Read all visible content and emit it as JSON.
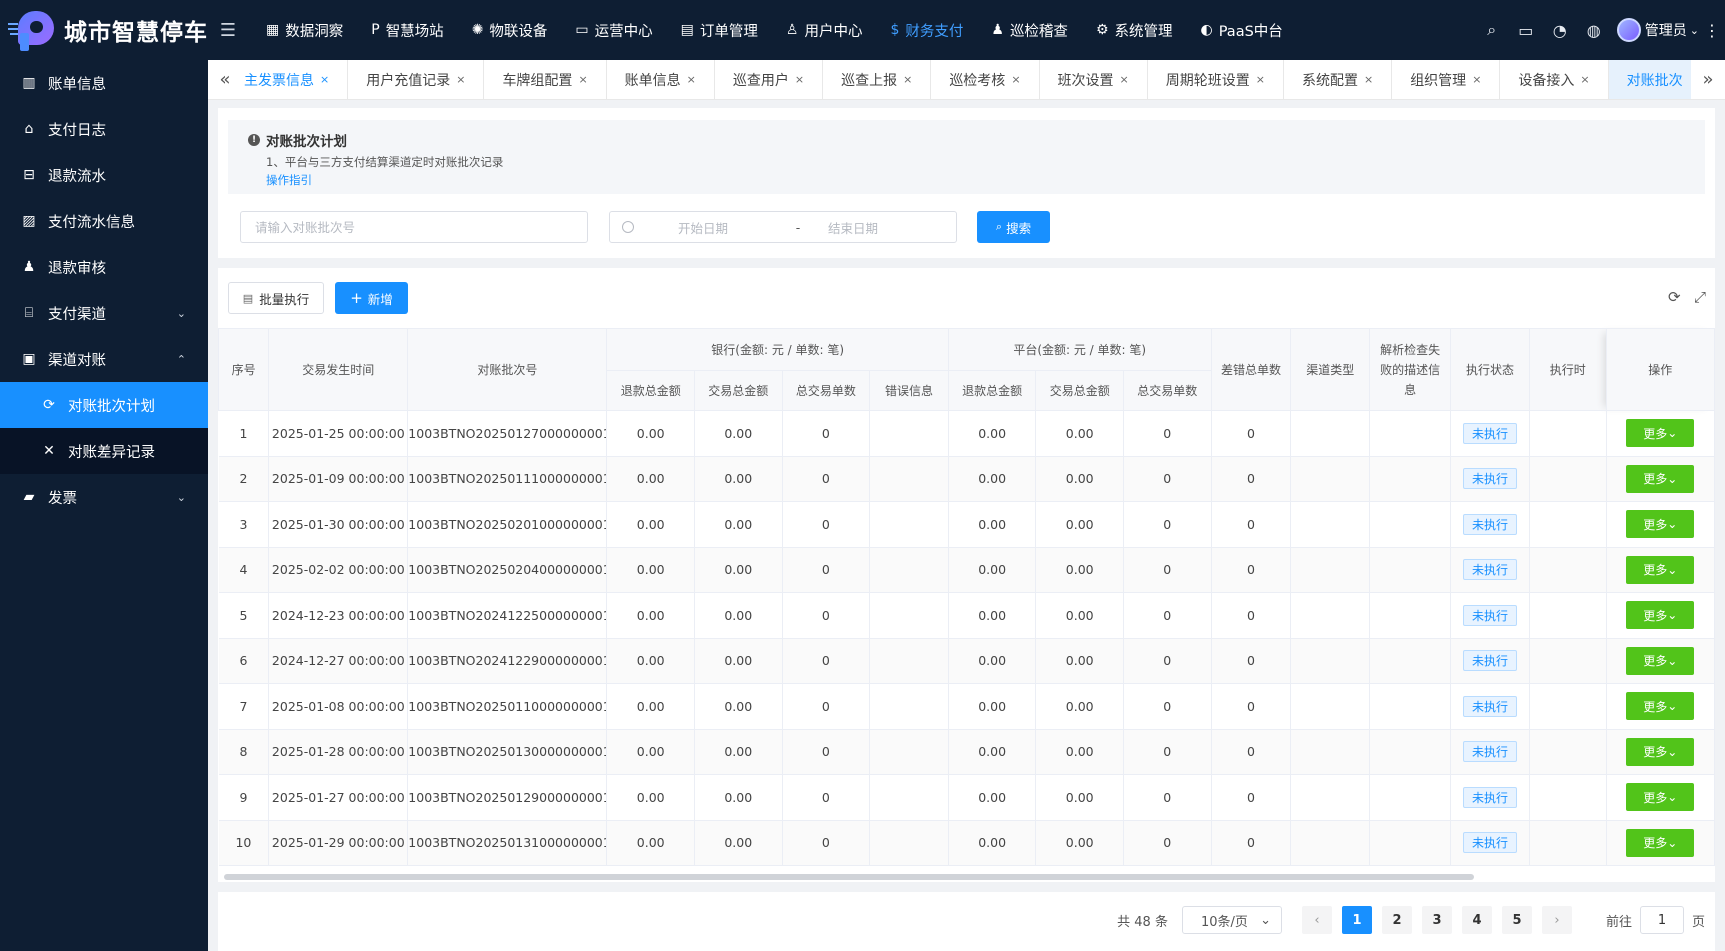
{
  "brand": {
    "title": "城市智慧停车"
  },
  "topnav": [
    {
      "label": "数据洞察",
      "icon": "▦"
    },
    {
      "label": "智慧场站",
      "icon": "P"
    },
    {
      "label": "物联设备",
      "icon": "✺"
    },
    {
      "label": "运营中心",
      "icon": "▭"
    },
    {
      "label": "订单管理",
      "icon": "▤"
    },
    {
      "label": "用户中心",
      "icon": "♙"
    },
    {
      "label": "财务支付",
      "icon": "$",
      "active": true
    },
    {
      "label": "巡检稽查",
      "icon": "♟"
    },
    {
      "label": "系统管理",
      "icon": "⚙"
    },
    {
      "label": "PaaS中台",
      "icon": "◐"
    }
  ],
  "user": {
    "name": "管理员"
  },
  "sidebar": {
    "items": [
      {
        "label": "账单信息",
        "icon": "▥"
      },
      {
        "label": "支付日志",
        "icon": "⌂"
      },
      {
        "label": "退款流水",
        "icon": "⊟"
      },
      {
        "label": "支付流水信息",
        "icon": "▨"
      },
      {
        "label": "退款审核",
        "icon": "♟"
      },
      {
        "label": "支付渠道",
        "icon": "⌸",
        "caret": "⌄"
      },
      {
        "label": "渠道对账",
        "icon": "▣",
        "caret": "⌃"
      }
    ],
    "sub": [
      {
        "label": "对账批次计划",
        "icon": "⟳",
        "active": true
      },
      {
        "label": "对账差异记录",
        "icon": "✕"
      }
    ],
    "last": {
      "label": "发票",
      "icon": "▰",
      "caret": "⌄"
    }
  },
  "tabs": [
    {
      "label": "主发票信息",
      "active": true
    },
    {
      "label": "用户充值记录"
    },
    {
      "label": "车牌组配置"
    },
    {
      "label": "账单信息"
    },
    {
      "label": "巡查用户"
    },
    {
      "label": "巡查上报"
    },
    {
      "label": "巡检考核"
    },
    {
      "label": "班次设置"
    },
    {
      "label": "周期轮班设置"
    },
    {
      "label": "系统配置"
    },
    {
      "label": "组织管理"
    },
    {
      "label": "设备接入"
    },
    {
      "label": "对账批次",
      "last": true
    }
  ],
  "notice": {
    "title": "对账批次计划",
    "line1": "1、平台与三方支付结算渠道定时对账批次记录",
    "link": "操作指引"
  },
  "search": {
    "batch_placeholder": "请输入对账批次号",
    "start_placeholder": "开始日期",
    "sep": "-",
    "end_placeholder": "结束日期",
    "button": "搜索"
  },
  "toolbar": {
    "batch_exec": "批量执行",
    "add": "新增"
  },
  "table": {
    "headers": {
      "seq": "序号",
      "time": "交易发生时间",
      "batch": "对账批次号",
      "bank_group": "银行(金额: 元 / 单数: 笔)",
      "platform_group": "平台(金额: 元 / 单数: 笔)",
      "bank_refund": "退款总金额",
      "bank_trade": "交易总金额",
      "bank_count": "总交易单数",
      "bank_error": "错误信息",
      "plat_refund": "退款总金额",
      "plat_trade": "交易总金额",
      "plat_count": "总交易单数",
      "diff": "差错总单数",
      "channel": "渠道类型",
      "parse": "解析检查失败的描述信息",
      "status": "执行状态",
      "exec_time": "执行时",
      "op": "操作"
    },
    "rows": [
      {
        "seq": "1",
        "time": "2025-01-25 00:00:00",
        "batch": "1003BTNO20250127000000001",
        "b_refund": "0.00",
        "b_trade": "0.00",
        "b_count": "0",
        "b_err": "",
        "p_refund": "0.00",
        "p_trade": "0.00",
        "p_count": "0",
        "diff": "0",
        "channel": "",
        "parse": "",
        "status": "未执行",
        "exec": "",
        "op": "更多"
      },
      {
        "seq": "2",
        "time": "2025-01-09 00:00:00",
        "batch": "1003BTNO20250111000000001",
        "b_refund": "0.00",
        "b_trade": "0.00",
        "b_count": "0",
        "b_err": "",
        "p_refund": "0.00",
        "p_trade": "0.00",
        "p_count": "0",
        "diff": "0",
        "channel": "",
        "parse": "",
        "status": "未执行",
        "exec": "",
        "op": "更多"
      },
      {
        "seq": "3",
        "time": "2025-01-30 00:00:00",
        "batch": "1003BTNO20250201000000001",
        "b_refund": "0.00",
        "b_trade": "0.00",
        "b_count": "0",
        "b_err": "",
        "p_refund": "0.00",
        "p_trade": "0.00",
        "p_count": "0",
        "diff": "0",
        "channel": "",
        "parse": "",
        "status": "未执行",
        "exec": "",
        "op": "更多"
      },
      {
        "seq": "4",
        "time": "2025-02-02 00:00:00",
        "batch": "1003BTNO20250204000000001",
        "b_refund": "0.00",
        "b_trade": "0.00",
        "b_count": "0",
        "b_err": "",
        "p_refund": "0.00",
        "p_trade": "0.00",
        "p_count": "0",
        "diff": "0",
        "channel": "",
        "parse": "",
        "status": "未执行",
        "exec": "",
        "op": "更多"
      },
      {
        "seq": "5",
        "time": "2024-12-23 00:00:00",
        "batch": "1003BTNO20241225000000001",
        "b_refund": "0.00",
        "b_trade": "0.00",
        "b_count": "0",
        "b_err": "",
        "p_refund": "0.00",
        "p_trade": "0.00",
        "p_count": "0",
        "diff": "0",
        "channel": "",
        "parse": "",
        "status": "未执行",
        "exec": "",
        "op": "更多"
      },
      {
        "seq": "6",
        "time": "2024-12-27 00:00:00",
        "batch": "1003BTNO20241229000000001",
        "b_refund": "0.00",
        "b_trade": "0.00",
        "b_count": "0",
        "b_err": "",
        "p_refund": "0.00",
        "p_trade": "0.00",
        "p_count": "0",
        "diff": "0",
        "channel": "",
        "parse": "",
        "status": "未执行",
        "exec": "",
        "op": "更多"
      },
      {
        "seq": "7",
        "time": "2025-01-08 00:00:00",
        "batch": "1003BTNO20250110000000001",
        "b_refund": "0.00",
        "b_trade": "0.00",
        "b_count": "0",
        "b_err": "",
        "p_refund": "0.00",
        "p_trade": "0.00",
        "p_count": "0",
        "diff": "0",
        "channel": "",
        "parse": "",
        "status": "未执行",
        "exec": "",
        "op": "更多"
      },
      {
        "seq": "8",
        "time": "2025-01-28 00:00:00",
        "batch": "1003BTNO20250130000000001",
        "b_refund": "0.00",
        "b_trade": "0.00",
        "b_count": "0",
        "b_err": "",
        "p_refund": "0.00",
        "p_trade": "0.00",
        "p_count": "0",
        "diff": "0",
        "channel": "",
        "parse": "",
        "status": "未执行",
        "exec": "",
        "op": "更多"
      },
      {
        "seq": "9",
        "time": "2025-01-27 00:00:00",
        "batch": "1003BTNO20250129000000001",
        "b_refund": "0.00",
        "b_trade": "0.00",
        "b_count": "0",
        "b_err": "",
        "p_refund": "0.00",
        "p_trade": "0.00",
        "p_count": "0",
        "diff": "0",
        "channel": "",
        "parse": "",
        "status": "未执行",
        "exec": "",
        "op": "更多"
      },
      {
        "seq": "10",
        "time": "2025-01-29 00:00:00",
        "batch": "1003BTNO20250131000000001",
        "b_refund": "0.00",
        "b_trade": "0.00",
        "b_count": "0",
        "b_err": "",
        "p_refund": "0.00",
        "p_trade": "0.00",
        "p_count": "0",
        "diff": "0",
        "channel": "",
        "parse": "",
        "status": "未执行",
        "exec": "",
        "op": "更多"
      }
    ]
  },
  "pagination": {
    "total": "共 48 条",
    "size": "10条/页",
    "pages": [
      "1",
      "2",
      "3",
      "4",
      "5"
    ],
    "current": "1",
    "goto": "前往",
    "goto_value": "1",
    "page_suffix": "页"
  },
  "colors": {
    "accent": "#1890ff",
    "sidebar_bg": "#0e1e33",
    "more_button": "#52c41a"
  }
}
